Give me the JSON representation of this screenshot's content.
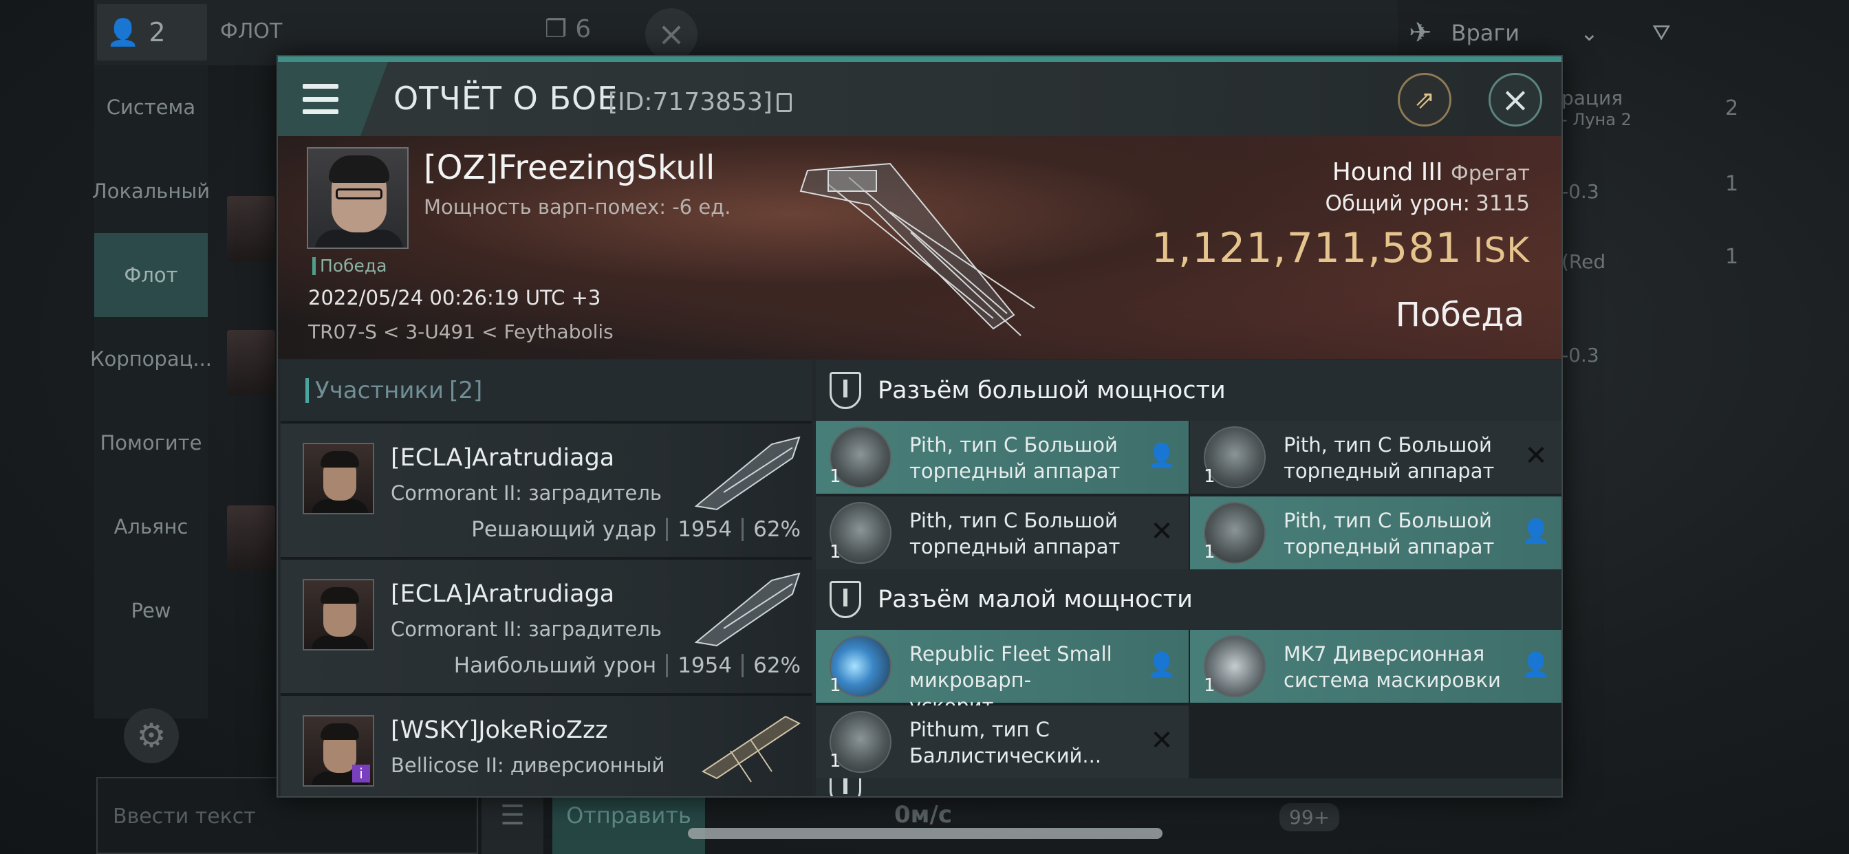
{
  "background": {
    "members_count": "2",
    "fleet_title": "ФЛОТ",
    "copy_count": "6",
    "enemies_label": "Враги",
    "sidebar_items": [
      "Система",
      "Локальный",
      "Флот",
      "Корпорац...",
      "Помогите",
      "Альянс",
      "Pew"
    ],
    "input_placeholder": "Ввести текст",
    "send_label": "Отправить",
    "speed": "0м/с",
    "badge": "99+",
    "right_texts": [
      "рация",
      "- Луна 2",
      "-0.3",
      "(Red",
      "-0.3"
    ],
    "right_counts": [
      "2",
      "1",
      "1"
    ]
  },
  "modal": {
    "title": "ОТЧЁТ О БОЕ",
    "report_id": "[ID:7173853]",
    "pilot": {
      "name": "[OZ]FreezingSkull",
      "warp_disruption": "Мощность варп-помех: -6 ед.",
      "result": "Победа",
      "datetime": "2022/05/24 00:26:19 UTC +3",
      "location": "TR07-S < 3-U491 < Feythabolis"
    },
    "ship": {
      "name": "Hound III",
      "class": "Фрегат",
      "damage_label": "Общий урон:",
      "damage_value": "3115",
      "isk_value": "1,121,711,581",
      "isk_unit": "ISK",
      "outcome": "Победа"
    },
    "participants": {
      "label": "Участники",
      "count": "[2]",
      "rows": [
        {
          "name": "[ECLA]Aratrudiaga",
          "ship": "Cormorant II: заградитель",
          "stat_label": "Решающий удар",
          "damage": "1954",
          "percent": "62%"
        },
        {
          "name": "[ECLA]Aratrudiaga",
          "ship": "Cormorant II: заградитель",
          "stat_label": "Наибольший урон",
          "damage": "1954",
          "percent": "62%"
        },
        {
          "name": "[WSKY]JokeRioZzz",
          "ship": "Bellicose II: диверсионный",
          "stat_label": "",
          "damage": "",
          "percent": ""
        }
      ]
    },
    "sections": [
      {
        "title": "Разъём большой мощности",
        "modules": [
          {
            "name": "Pith, тип C Большой\nторпедный аппарат",
            "qty": "1",
            "state": "fitted",
            "icon": "torpedo-launcher-icon"
          },
          {
            "name": "Pith, тип C Большой\nторпедный аппарат",
            "qty": "1",
            "state": "destroyed",
            "icon": "torpedo-launcher-icon"
          },
          {
            "name": "Pith, тип C Большой\nторпедный аппарат",
            "qty": "1",
            "state": "destroyed",
            "icon": "torpedo-launcher-icon"
          },
          {
            "name": "Pith, тип C Большой\nторпедный аппарат",
            "qty": "1",
            "state": "fitted",
            "icon": "torpedo-launcher-icon"
          }
        ]
      },
      {
        "title": "Разъём малой мощности",
        "modules": [
          {
            "name": "Republic Fleet Small\nмикроварп-ускорит....",
            "qty": "1",
            "state": "fitted",
            "icon": "microwarpdrive-icon"
          },
          {
            "name": "MK7 Диверсионная\nсистема маскировки",
            "qty": "1",
            "state": "fitted",
            "icon": "cloaking-device-icon"
          },
          {
            "name": "Pithum, тип C\nБаллистический...",
            "qty": "1",
            "state": "destroyed",
            "icon": "ballistic-module-icon"
          }
        ]
      }
    ]
  },
  "colors": {
    "accent": "#3f8f88",
    "isk": "#e6c48d",
    "fitted_bg": "#487e79"
  }
}
